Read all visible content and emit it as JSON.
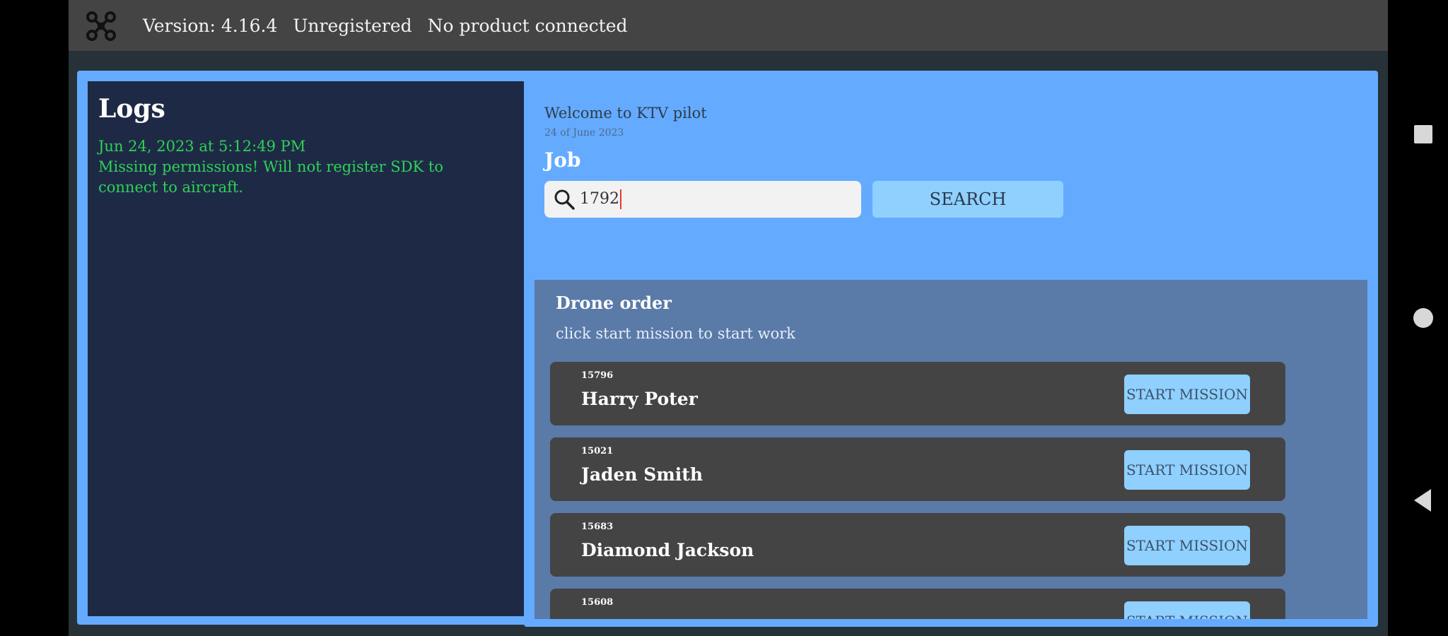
{
  "topbar": {
    "icon": "drone-icon",
    "version": "Version: 4.16.4",
    "registration": "Unregistered",
    "product_status": "No product connected"
  },
  "logs": {
    "title": "Logs",
    "lines": [
      "Jun 24, 2023 at 5:12:49 PM",
      "Missing permissions! Will not register SDK to connect to aircraft."
    ]
  },
  "main": {
    "welcome": "Welcome to KTV pilot",
    "date": "24 of June 2023",
    "job_label": "Job",
    "search": {
      "icon": "search-icon",
      "value": "1792",
      "button_label": "SEARCH"
    },
    "orders": {
      "title": "Drone order",
      "subtitle": "click start mission to start work",
      "button_label": "START MISSION",
      "items": [
        {
          "id": "15796",
          "name": "Harry Poter"
        },
        {
          "id": "15021",
          "name": "Jaden Smith"
        },
        {
          "id": "15683",
          "name": "Diamond Jackson"
        },
        {
          "id": "15608",
          "name": ""
        }
      ]
    }
  },
  "system_nav": {
    "recents": "square-icon",
    "home": "circle-icon",
    "back": "back-triangle-icon"
  },
  "colors": {
    "accent_blue": "#64abff",
    "button_blue": "#8fd0ff",
    "log_green": "#2ed158",
    "panel_dark": "#1e2a45"
  }
}
